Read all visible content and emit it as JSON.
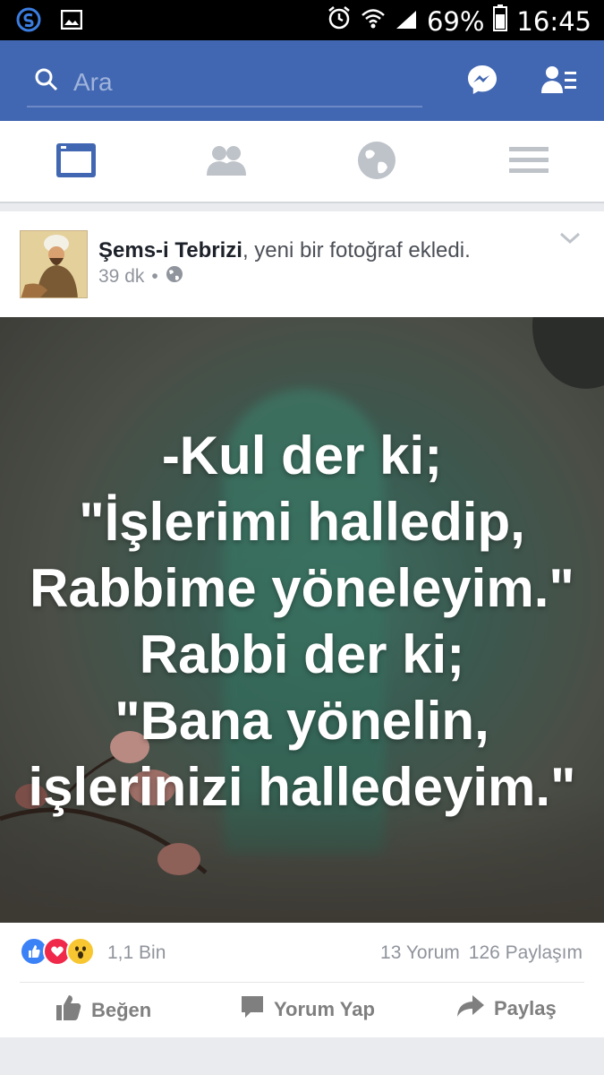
{
  "status_bar": {
    "battery": "69%",
    "time": "16:45"
  },
  "navbar": {
    "search_placeholder": "Ara"
  },
  "post": {
    "author": "Şems-i Tebrizi",
    "action_text": ", yeni bir fotoğraf ekledi.",
    "time": "39 dk",
    "separator": "•",
    "quote_lines": [
      "-Kul der ki;",
      "\"İşlerimi halledip,",
      "Rabbime yöneleyim.\"",
      "Rabbi der ki;",
      "\"Bana yönelin,",
      "işlerinizi halledeyim.\""
    ],
    "reactions_count": "1,1 Bin",
    "comments": "13 Yorum",
    "shares": "126 Paylaşım",
    "actions": {
      "like": "Beğen",
      "comment": "Yorum Yap",
      "share": "Paylaş"
    }
  },
  "colors": {
    "brand": "#4267b2",
    "like": "#3b82f6",
    "love": "#f0284a",
    "wow": "#f7c631"
  }
}
